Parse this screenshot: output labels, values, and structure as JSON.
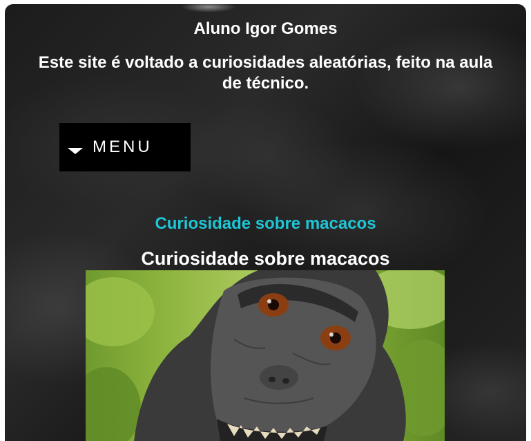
{
  "header": {
    "author": "Aluno Igor Gomes",
    "description": "Este site é voltado a curiosidades aleatórias, feito na aula de técnico."
  },
  "menu": {
    "label": "MENU",
    "icon": "caret-down-icon"
  },
  "content": {
    "link_text": "Curiosidade sobre macacos",
    "section_title": "Curiosidade sobre macacos",
    "image_subject": "macaque-selfie-photo"
  },
  "colors": {
    "link": "#1ec6d6",
    "text": "#ffffff",
    "menu_background": "#000000"
  }
}
